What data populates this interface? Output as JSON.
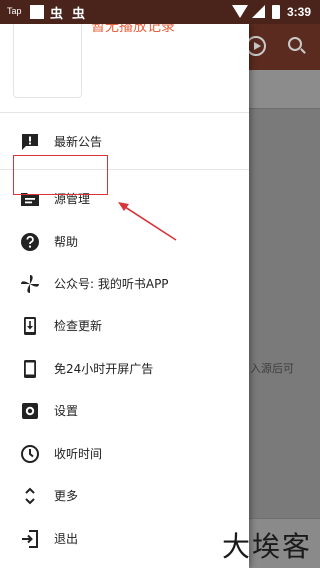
{
  "status_bar": {
    "carrier": "Tap",
    "app_glyph_1": "虫",
    "app_glyph_2": "虫",
    "time": "3:39"
  },
  "drawer": {
    "header_empty_text": "暂无播放记录",
    "menu": [
      {
        "icon": "notice-icon",
        "label": "最新公告"
      },
      {
        "icon": "folder-icon",
        "label": "源管理"
      },
      {
        "icon": "help-icon",
        "label": "帮助"
      },
      {
        "icon": "pinwheel-icon",
        "label": "公众号: 我的听书APP"
      },
      {
        "icon": "download-phone-icon",
        "label": "检查更新"
      },
      {
        "icon": "phone-icon",
        "label": "免24小时开屏广告"
      },
      {
        "icon": "gear-icon",
        "label": "设置"
      },
      {
        "icon": "timer-icon",
        "label": "收听时间"
      },
      {
        "icon": "expand-icon",
        "label": "更多"
      },
      {
        "icon": "exit-icon",
        "label": "退出"
      }
    ]
  },
  "background": {
    "hint_text": "入源后可"
  },
  "watermark": {
    "text": "大埃客"
  },
  "colors": {
    "toolbar": "#5c2b1f",
    "accent": "#e8603c",
    "highlight": "#d9343a"
  }
}
